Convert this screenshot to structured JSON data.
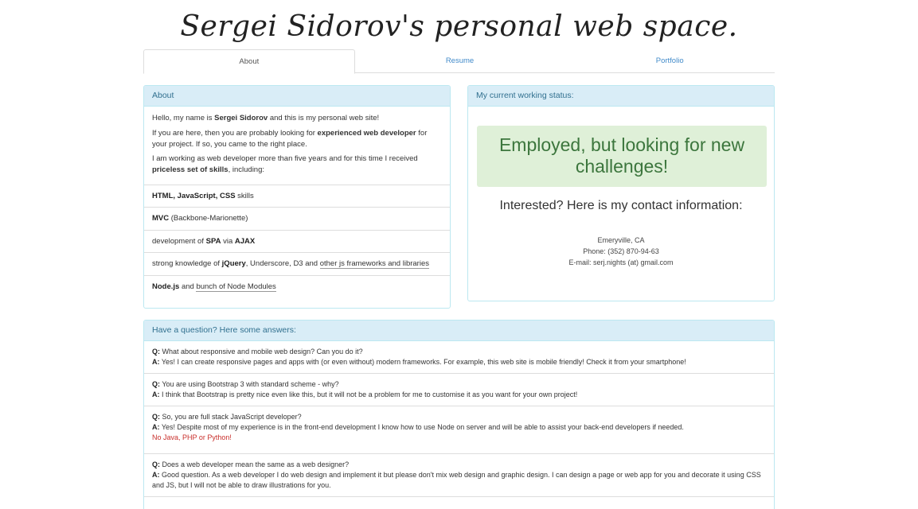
{
  "header": {
    "title": "Sergei Sidorov's personal web space."
  },
  "tabs": [
    {
      "label": "About",
      "active": true
    },
    {
      "label": "Resume",
      "active": false
    },
    {
      "label": "Portfolio",
      "active": false
    }
  ],
  "about": {
    "heading": "About",
    "p1": {
      "a": "Hello, my name is ",
      "b": "Sergei Sidorov",
      "c": " and this is my personal web site!"
    },
    "p2": {
      "a": "If you are here, then you are probably looking for ",
      "b": "experienced web developer",
      "c": " for your project. If so, you came to the right place."
    },
    "p3": {
      "a": "I am working as web developer more than five years and for this time I received ",
      "b": "priceless set of skills",
      "c": ", including:"
    },
    "skills": {
      "s1": {
        "b": "HTML, JavaScript, CSS",
        "c": " skills"
      },
      "s2": {
        "b": "MVC",
        "c": " (Backbone-Marionette)"
      },
      "s3": {
        "a": "development of ",
        "b": "SPA",
        "m": " via ",
        "b2": "AJAX"
      },
      "s4": {
        "a": "strong knowledge of ",
        "b": "jQuery",
        "c": ", Underscore, D3 and ",
        "link": "other js frameworks and libraries"
      },
      "s5": {
        "b": "Node.js",
        "c": " and ",
        "link": "bunch of Node Modules"
      }
    }
  },
  "status": {
    "heading": "My current working status:",
    "message": "Employed, but looking for new challenges!",
    "interested": "Interested? Here is my contact information:",
    "location": "Emeryville, CA",
    "phone": "Phone: (352) 870-94-63",
    "email": "E-mail: serj.nights (at) gmail.com",
    "colors": {
      "success_bg": "#dff0d8",
      "success_text": "#3c763d"
    }
  },
  "faq": {
    "heading": "Have a question? Here some answers:",
    "q_prefix": "Q:",
    "a_prefix": "A:",
    "items": [
      {
        "q": " What about responsive and mobile web design? Can you do it?",
        "a": " Yes! I can create responsive pages and apps with (or even without) modern frameworks. For example, this web site is mobile friendly! Check it from your smartphone!"
      },
      {
        "q": " You are using Bootstrap 3 with standard scheme - why?",
        "a": " I think that Bootstrap is pretty nice even like this, but it will not be a problem for me to customise it as you want for your own project!"
      },
      {
        "q": " So, you are full stack JavaScript developer?",
        "a": " Yes! Despite most of my experience is in the front-end development I know how to use Node on server and will be able to assist your back-end developers if needed.",
        "note": "No Java, PHP or Python!"
      },
      {
        "q": " Does a web developer mean the same as a web designer?",
        "a": " Good question. As a web developer I do web design and implement it but please don't mix web design and graphic design. I can design a page or web app for you and decorate it using CSS and JS, but I will not be able to draw illustrations for you."
      }
    ]
  },
  "theme": {
    "link": "#428bca",
    "panel_heading_bg": "#d9edf7",
    "panel_heading_text": "#31708f",
    "panel_border": "#bce8f1",
    "note_red": "#c9302c"
  }
}
